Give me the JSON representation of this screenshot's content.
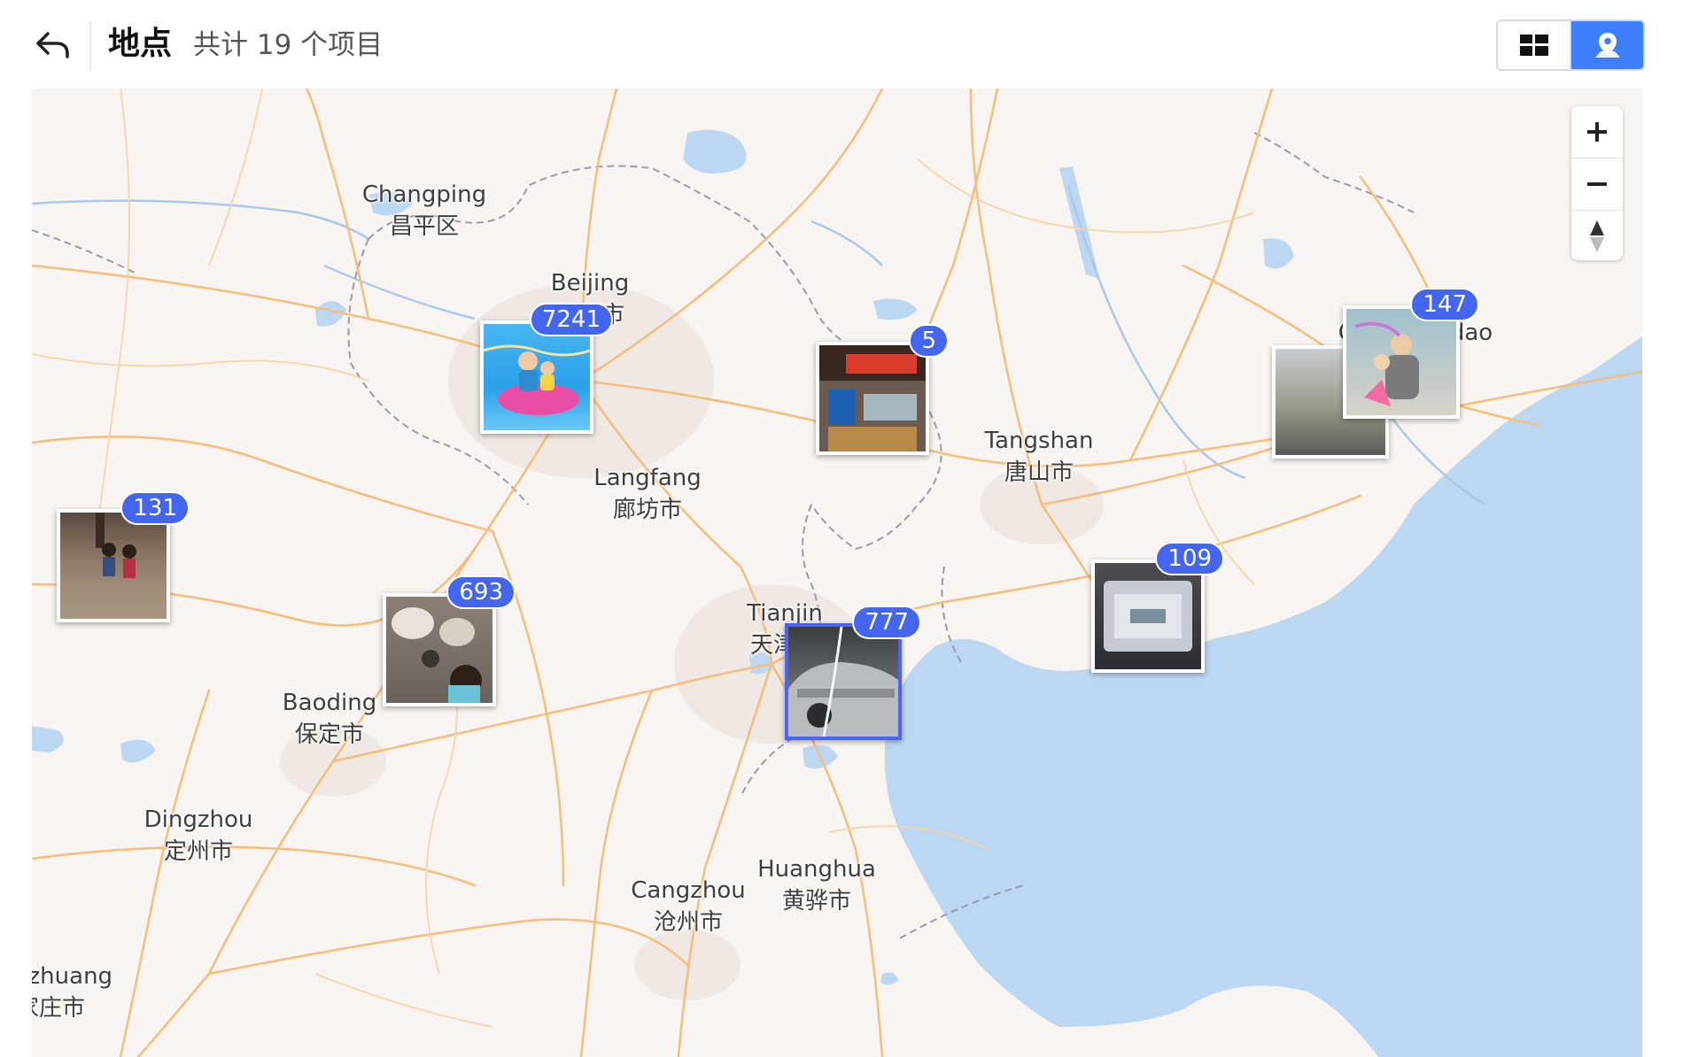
{
  "header": {
    "title": "地点",
    "item_count": "共计 19 个项目",
    "back_icon": "back-arrow-icon",
    "view_modes": [
      {
        "name": "grid",
        "icon": "grid-icon",
        "active": false
      },
      {
        "name": "map",
        "icon": "map-pin-icon",
        "active": true
      }
    ]
  },
  "colors": {
    "accent": "#3d7eff",
    "badge": "#4466ee",
    "map_land": "#f8f4f1",
    "map_water": "#bcd7f2",
    "map_road": "#f2bf7c"
  },
  "map": {
    "cities": [
      {
        "en": "Changping",
        "zh": "昌平区"
      },
      {
        "en": "Beijing",
        "zh": "北京市"
      },
      {
        "en": "Langfang",
        "zh": "廊坊市"
      },
      {
        "en": "Tangshan",
        "zh": "唐山市"
      },
      {
        "en": "Tianjin",
        "zh": "天津市"
      },
      {
        "en": "Baoding",
        "zh": "保定市"
      },
      {
        "en": "Dingzhou",
        "zh": "定州市"
      },
      {
        "en": "Cangzhou",
        "zh": "沧州市"
      },
      {
        "en": "Huanghua",
        "zh": "黄骅市"
      },
      {
        "en": "Qinhuangdao",
        "zh": ""
      },
      {
        "en": "Shijiazhuang",
        "zh": "石家庄市"
      }
    ],
    "clusters": [
      {
        "count": "7241",
        "thumb": "pool-photo",
        "selected": false
      },
      {
        "count": "5",
        "thumb": "shop-photo",
        "selected": false
      },
      {
        "count": "147",
        "thumb": "family-photo",
        "selected": false
      },
      {
        "count": "131",
        "thumb": "kids-hall-photo",
        "selected": false
      },
      {
        "count": "693",
        "thumb": "toddler-photo",
        "selected": false
      },
      {
        "count": "777",
        "thumb": "car-wash-photo",
        "selected": true
      },
      {
        "count": "109",
        "thumb": "screen-photo",
        "selected": false
      }
    ],
    "controls": {
      "zoom_in_icon": "plus-icon",
      "zoom_out_icon": "minus-icon",
      "compass_icon": "compass-icon"
    }
  }
}
